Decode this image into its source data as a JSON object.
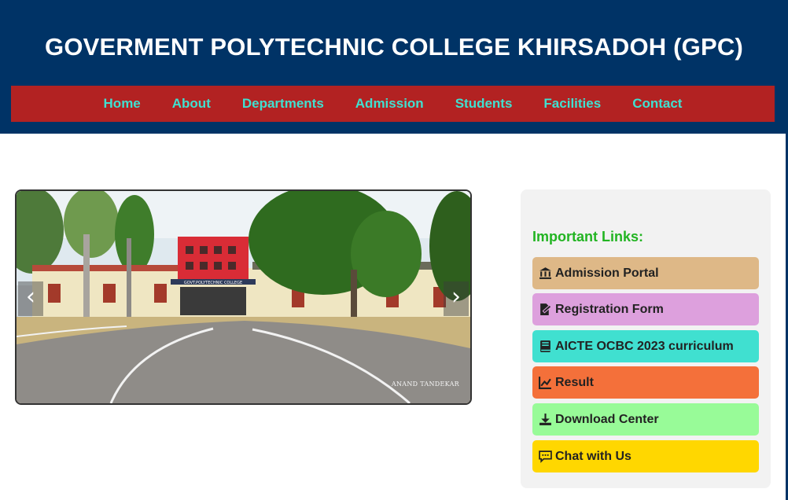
{
  "header": {
    "title": "GOVERMENT POLYTECHNIC COLLEGE KHIRSADOH (GPC)",
    "bg_color": "#003366"
  },
  "nav": {
    "bg_color": "#b22222",
    "text_color": "#40e0d0",
    "items": [
      "Home",
      "About",
      "Departments",
      "Admission",
      "Students",
      "Facilities",
      "Contact"
    ]
  },
  "slider": {
    "prev_icon": "‹",
    "next_icon": "›",
    "building_sign": "GOVT.POLYTECHNIC COLLEGE",
    "watermark": "ANAND TANDEKAR"
  },
  "links": {
    "heading": "Important Links:",
    "heading_color": "#22b422",
    "items": [
      {
        "label": "Admission Portal",
        "icon": "bank-icon",
        "color": "#deb887"
      },
      {
        "label": "Registration Form",
        "icon": "file-signature-icon",
        "color": "#dda0dd"
      },
      {
        "label": "AICTE OCBC 2023 curriculum",
        "icon": "book-icon",
        "color": "#40e0d0"
      },
      {
        "label": "Result",
        "icon": "line-chart-icon",
        "color": "#f4703a"
      },
      {
        "label": "Download Center",
        "icon": "download-icon",
        "color": "#98fb98"
      },
      {
        "label": "Chat with Us",
        "icon": "chat-icon",
        "color": "#ffd700"
      }
    ]
  }
}
